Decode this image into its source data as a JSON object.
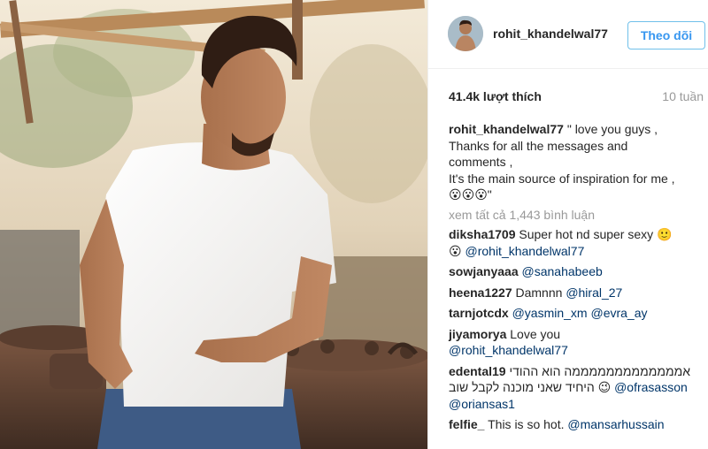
{
  "post": {
    "username": "rohit_khandelwal77",
    "follow_label": "Theo dõi",
    "likes": "41.4k lượt thích",
    "time_ago": "10 tuần",
    "caption_lines": [
      "\" love you guys ,",
      "Thanks for all the messages and",
      "comments ,",
      "It's the main source of inspiration for me ,",
      "😮😮😮\""
    ],
    "view_all_comments": "xem tất cả 1,443 bình luận"
  },
  "comments": [
    {
      "user": "diksha1709",
      "text": "Super hot nd super sexy 🙂",
      "text2": "😮",
      "mention": "@rohit_khandelwal77"
    },
    {
      "user": "sowjanyaaa",
      "text": "",
      "mention": "@sanahabeeb"
    },
    {
      "user": "heena1227",
      "text": "Damnnn",
      "mention": "@hiral_27"
    },
    {
      "user": "tarnjotcdx",
      "text": "",
      "mention": "@yasmin_xm",
      "mention2": "@evra_ay"
    },
    {
      "user": "jiyamorya",
      "text": "Love you",
      "mention": "@rohit_khandelwal77"
    },
    {
      "user": "edental19",
      "text": "אמממממממממממממה הוא ההודי",
      "text2": "היחיד שאני מוכנה לקבל שוב 😉",
      "mention": "@ofrasasson",
      "mention2": "@oriansas1"
    },
    {
      "user": "felfie_",
      "text": "This is so hot.",
      "mention": "@mansarhussain"
    }
  ],
  "colors": {
    "link": "#003569",
    "follow": "#3897f0",
    "muted": "#999999"
  },
  "icons": [
    "avatar-image",
    "post-photo"
  ]
}
